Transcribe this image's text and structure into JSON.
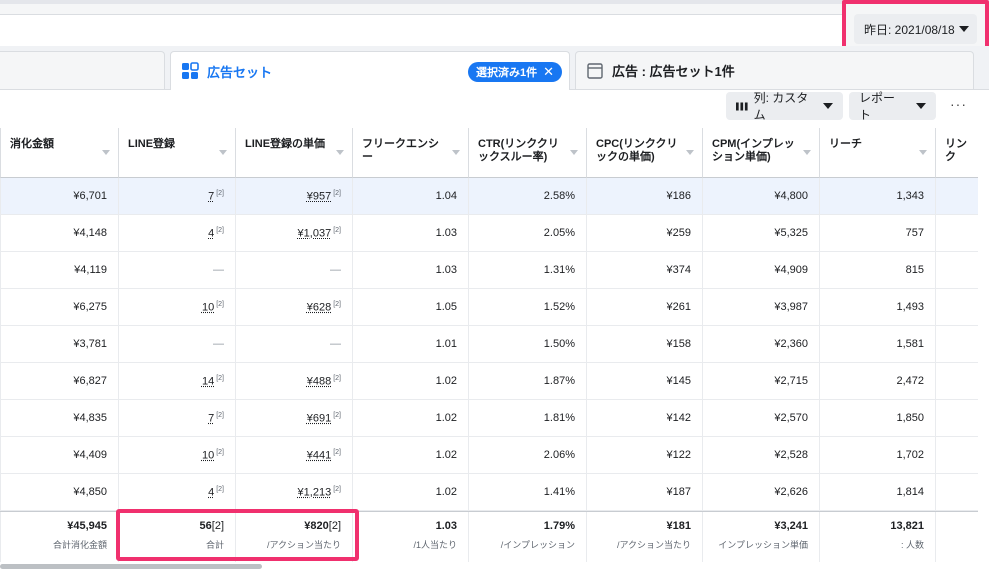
{
  "date_selector": {
    "label": "昨日: 2021/08/18"
  },
  "tabs": {
    "adsets": {
      "label": "広告セット",
      "chip": "選択済み1件"
    },
    "ads": {
      "label": "広告 : 広告セット1件"
    }
  },
  "toolbar": {
    "columns_label": "列: カスタム",
    "report_label": "レポート",
    "more": "···"
  },
  "table": {
    "headers": [
      "消化金額",
      "LINE登録",
      "LINE登録の単価",
      "フリークエンシー",
      "CTR(リンククリックスルー率)",
      "CPC(リンククリックの単価)",
      "CPM(インプレッション単価)",
      "リーチ",
      "リンク"
    ],
    "sup": "[2]",
    "rows": [
      [
        "¥6,701",
        "7",
        "¥957",
        "1.04",
        "2.58%",
        "¥186",
        "¥4,800",
        "1,343"
      ],
      [
        "¥4,148",
        "4",
        "¥1,037",
        "1.03",
        "2.05%",
        "¥259",
        "¥5,325",
        "757"
      ],
      [
        "¥4,119",
        "—",
        "—",
        "1.03",
        "1.31%",
        "¥374",
        "¥4,909",
        "815"
      ],
      [
        "¥6,275",
        "10",
        "¥628",
        "1.05",
        "1.52%",
        "¥261",
        "¥3,987",
        "1,493"
      ],
      [
        "¥3,781",
        "—",
        "—",
        "1.01",
        "1.50%",
        "¥158",
        "¥2,360",
        "1,581"
      ],
      [
        "¥6,827",
        "14",
        "¥488",
        "1.02",
        "1.87%",
        "¥145",
        "¥2,715",
        "2,472"
      ],
      [
        "¥4,835",
        "7",
        "¥691",
        "1.02",
        "1.81%",
        "¥142",
        "¥2,570",
        "1,850"
      ],
      [
        "¥4,409",
        "10",
        "¥441",
        "1.02",
        "2.06%",
        "¥122",
        "¥2,528",
        "1,702"
      ],
      [
        "¥4,850",
        "4",
        "¥1,213",
        "1.02",
        "1.41%",
        "¥187",
        "¥2,626",
        "1,814"
      ]
    ],
    "totals": [
      {
        "value": "¥45,945",
        "label": "合計消化金額"
      },
      {
        "value": "56",
        "label": "合計"
      },
      {
        "value": "¥820",
        "label": "/アクション当たり"
      },
      {
        "value": "1.03",
        "label": "/1人当たり"
      },
      {
        "value": "1.79%",
        "label": "/インプレッション"
      },
      {
        "value": "¥181",
        "label": "/アクション当たり"
      },
      {
        "value": "¥3,241",
        "label": "インプレッション単価"
      },
      {
        "value": "13,821",
        "label": ": 人数"
      }
    ]
  },
  "colors": {
    "accent": "#1877f2",
    "highlight": "#f0306e"
  }
}
